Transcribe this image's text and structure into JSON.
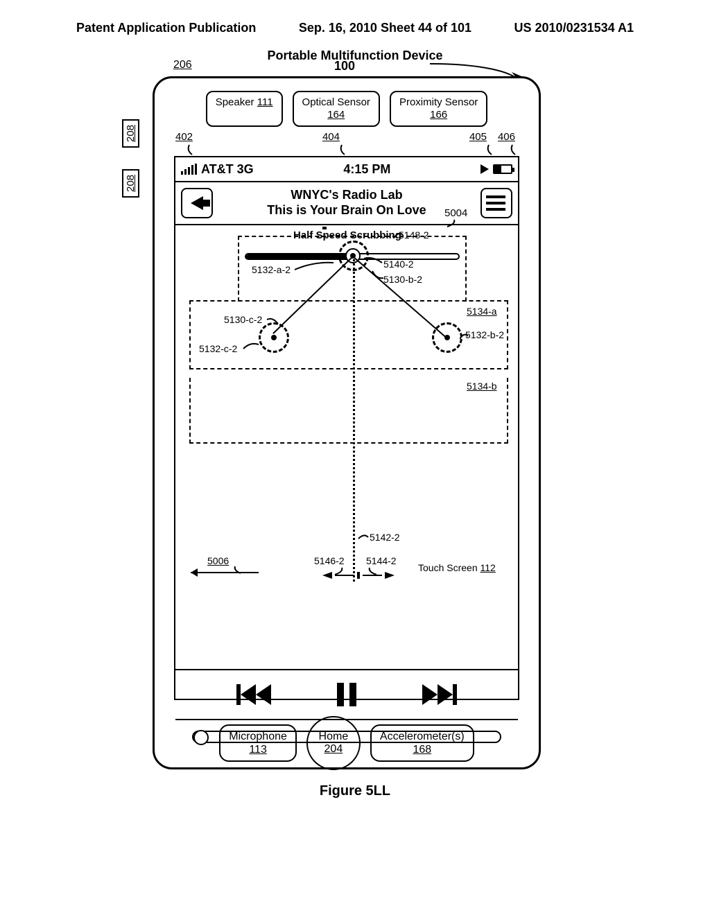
{
  "page_header": {
    "left": "Patent Application Publication",
    "center": "Sep. 16, 2010  Sheet 44 of 101",
    "right": "US 2010/0231534 A1"
  },
  "device": {
    "title": "Portable Multifunction Device",
    "ref_100": "100",
    "ref_206": "206",
    "ref_208": "208",
    "sensors": {
      "speaker_label": "Speaker",
      "speaker_ref": "111",
      "optical_label": "Optical Sensor",
      "optical_ref": "164",
      "prox_label": "Proximity Sensor",
      "prox_ref": "166"
    },
    "top_refs": {
      "r402": "402",
      "r404": "404",
      "r405": "405",
      "r406": "406"
    },
    "statusbar": {
      "carrier": "AT&T 3G",
      "time": "4:15 PM"
    },
    "now_playing": {
      "title": "WNYC's Radio Lab",
      "subtitle": "This is Your Brain On Love",
      "ref_5004": "5004"
    },
    "scrubbing": {
      "label": "Half Speed Scrubbing",
      "ref_5148_2": "5148-2",
      "ref_5132_a_2": "5132-a-2",
      "ref_5140_2": "5140-2",
      "ref_5130_b_2": "5130-b-2",
      "ref_5130_c_2": "5130-c-2",
      "ref_5132_b_2": "5132-b-2",
      "ref_5132_c_2": "5132-c-2",
      "ref_5134_a": "5134-a",
      "ref_5134_b": "5134-b",
      "ref_5142_2": "5142-2",
      "ref_5146_2": "5146-2",
      "ref_5144_2": "5144-2",
      "ref_5006": "5006",
      "touch_screen": "Touch Screen",
      "touch_ref": "112"
    },
    "hw": {
      "mic_label": "Microphone",
      "mic_ref": "113",
      "home_label": "Home",
      "home_ref": "204",
      "accel_label": "Accelerometer(s)",
      "accel_ref": "168"
    }
  },
  "figure_label": "Figure 5LL"
}
